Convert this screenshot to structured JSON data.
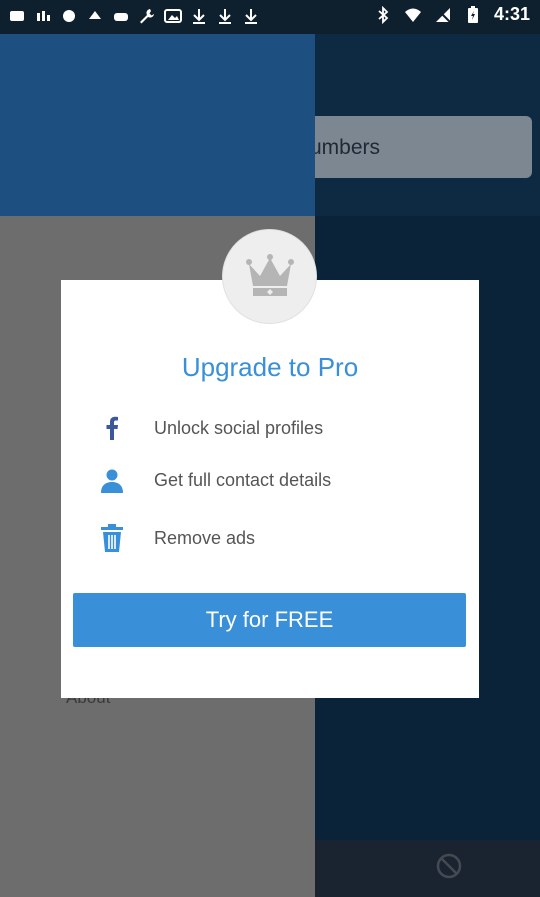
{
  "status_bar": {
    "time": "4:31"
  },
  "background": {
    "search_placeholder": "umbers",
    "drawer_about": "About"
  },
  "modal": {
    "title": "Upgrade to Pro",
    "features": [
      {
        "icon": "facebook-icon",
        "label": "Unlock social profiles"
      },
      {
        "icon": "person-icon",
        "label": "Get full contact details"
      },
      {
        "icon": "trash-icon",
        "label": "Remove ads"
      }
    ],
    "cta_label": "Try for FREE",
    "crown_icon": "crown-icon"
  },
  "colors": {
    "accent": "#3a8fd9",
    "modal_bg": "#ffffff",
    "text": "#555555"
  }
}
